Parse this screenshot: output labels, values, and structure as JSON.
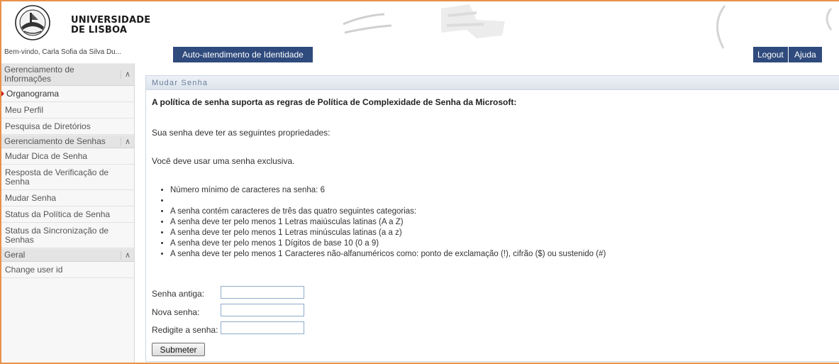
{
  "header": {
    "university_line1": "UNIVERSIDADE",
    "university_line2": "DE LISBOA",
    "welcome": "Bem-vindo, Carla Sofia da Silva Du...",
    "app_title": "Auto-atendimento de Identidade",
    "logout_label": "Logout",
    "help_label": "Ajuda"
  },
  "sidebar": {
    "sections": [
      {
        "title": "Gerenciamento de Informações",
        "items": [
          "Organograma",
          "Meu Perfil",
          "Pesquisa de Diretórios"
        ]
      },
      {
        "title": "Gerenciamento de Senhas",
        "items": [
          "Mudar Dica de Senha",
          "Resposta de Verificação de Senha",
          "Mudar Senha",
          "Status da Política de Senha",
          "Status da Sincronização de Senhas"
        ]
      },
      {
        "title": "Geral",
        "items": [
          "Change user id"
        ]
      }
    ],
    "active_item": "Organograma"
  },
  "panel": {
    "title": "Mudar Senha",
    "policy_heading": "A política de senha suporta as regras de Política de Complexidade de Senha da Microsoft:",
    "properties_text": "Sua senha deve ter as seguintes propriedades:",
    "unique_text": "Você deve usar uma senha exclusiva.",
    "rules": [
      "Número mínimo de caracteres na senha: 6",
      "",
      "A senha contém caracteres de três das quatro seguintes categorias:",
      "A senha deve ter pelo menos 1 Letras maiúsculas latinas (A a Z)",
      "A senha deve ter pelo menos 1 Letras minúsculas latinas (a a z)",
      "A senha deve ter pelo menos 1 Dígitos de base 10 (0 a 9)",
      "A senha deve ter pelo menos 1 Caracteres não-alfanuméricos como: ponto de exclamação (!), cifrão ($) ou sustenido (#)"
    ],
    "form": {
      "old_password_label": "Senha antiga:",
      "new_password_label": "Nova senha:",
      "confirm_password_label": "Redigite a senha:",
      "old_password_value": "",
      "new_password_value": "",
      "confirm_password_value": "",
      "submit_label": "Submeter"
    }
  },
  "colors": {
    "frame_orange": "#e8914a",
    "nav_blue": "#2f4a7d",
    "active_marker": "#cc1f1f"
  }
}
